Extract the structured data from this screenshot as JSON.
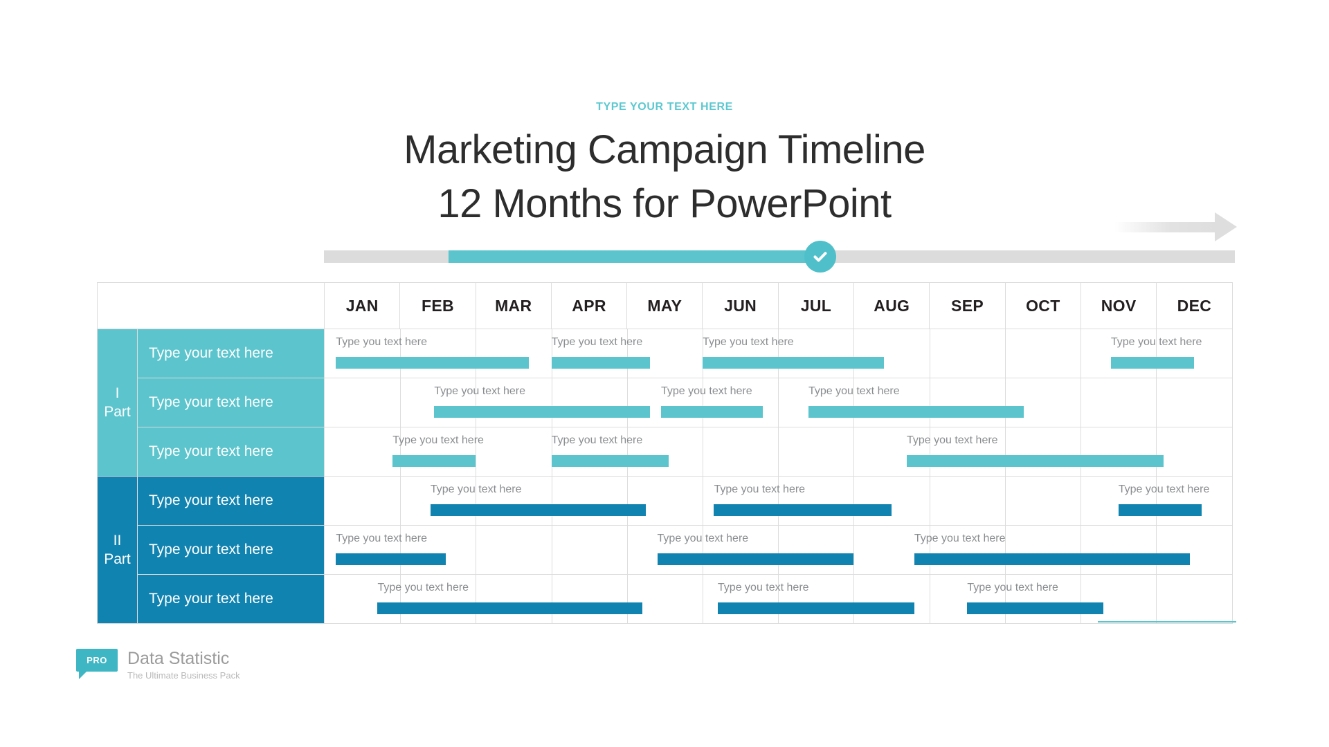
{
  "header": {
    "eyebrow": "TYPE YOUR TEXT HERE",
    "title_line1": "Marketing Campaign Timeline",
    "title_line2": "12 Months for PowerPoint",
    "eyebrow_color": "#5cc8d0",
    "title_color": "#2d2d2d"
  },
  "progress": {
    "track_color": "#dcdcdc",
    "fill_color": "#5bc4cd",
    "fill_start_pct": 13.7,
    "fill_end_pct": 54.5,
    "marker_pct": 54.5,
    "marker_icon": "check-circle-icon",
    "marker_color": "#4fc0ca"
  },
  "arrow": {
    "icon": "right-arrow-icon",
    "color": "#dedede"
  },
  "chart_data": {
    "type": "bar",
    "title": "Marketing Campaign Timeline 12 Months for PowerPoint",
    "categories": [
      "JAN",
      "FEB",
      "MAR",
      "APR",
      "MAY",
      "JUN",
      "JUL",
      "AUG",
      "SEP",
      "OCT",
      "NOV",
      "DEC"
    ],
    "xlabel": "",
    "ylabel": "",
    "grid": true,
    "legend": "none",
    "groups": [
      {
        "name": "I Part",
        "color": "#5bc4cd",
        "rows": [
          {
            "label": "Type your text here",
            "bars": [
              {
                "label": "Type you text here",
                "start_month": 0.15,
                "end_month": 2.7
              },
              {
                "label": "Type you text here",
                "start_month": 3.0,
                "end_month": 4.3
              },
              {
                "label": "Type you text here",
                "start_month": 5.0,
                "end_month": 7.4
              },
              {
                "label": "Type you text here",
                "start_month": 10.4,
                "end_month": 11.5
              }
            ]
          },
          {
            "label": "Type your text here",
            "bars": [
              {
                "label": "Type you text here",
                "start_month": 1.45,
                "end_month": 4.3
              },
              {
                "label": "Type you text here",
                "start_month": 4.45,
                "end_month": 5.8
              },
              {
                "label": "Type you text here",
                "start_month": 6.4,
                "end_month": 9.25
              }
            ]
          },
          {
            "label": "Type your text here",
            "bars": [
              {
                "label": "Type you text here",
                "start_month": 0.9,
                "end_month": 2.0
              },
              {
                "label": "Type you text here",
                "start_month": 3.0,
                "end_month": 4.55
              },
              {
                "label": "Type you text here",
                "start_month": 7.7,
                "end_month": 11.1
              }
            ]
          }
        ]
      },
      {
        "name": "II Part",
        "color": "#1183b0",
        "rows": [
          {
            "label": "Type your text here",
            "bars": [
              {
                "label": "Type you text here",
                "start_month": 1.4,
                "end_month": 4.25
              },
              {
                "label": "Type you text here",
                "start_month": 5.15,
                "end_month": 7.5
              },
              {
                "label": "Type you text here",
                "start_month": 10.5,
                "end_month": 11.6
              }
            ]
          },
          {
            "label": "Type your text here",
            "bars": [
              {
                "label": "Type you text here",
                "start_month": 0.15,
                "end_month": 1.6
              },
              {
                "label": "Type you text here",
                "start_month": 4.4,
                "end_month": 7.0
              },
              {
                "label": "Type you text here",
                "start_month": 7.8,
                "end_month": 11.45
              }
            ]
          },
          {
            "label": "Type your text here",
            "bars": [
              {
                "label": "Type you text here",
                "start_month": 0.7,
                "end_month": 4.2
              },
              {
                "label": "Type you text here",
                "start_month": 5.2,
                "end_month": 7.8
              },
              {
                "label": "Type you text here",
                "start_month": 8.5,
                "end_month": 10.3
              }
            ]
          }
        ]
      }
    ]
  },
  "footer": {
    "badge": "PRO",
    "brand_name": "Data Statistic",
    "tagline": "The Ultimate Business Pack",
    "badge_color": "#3fb6c4"
  }
}
